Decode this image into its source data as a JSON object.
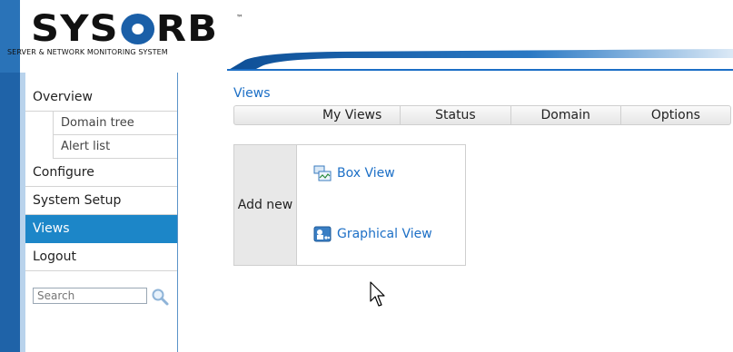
{
  "brand": {
    "name_part1": "SYS",
    "name_part2": "RB",
    "trademark": "™",
    "subtitle": "SERVER & NETWORK MONITORING SYSTEM"
  },
  "sidebar": {
    "items": [
      {
        "label": "Overview",
        "active": false
      },
      {
        "label": "Domain tree",
        "sub": true
      },
      {
        "label": "Alert list",
        "sub": true
      },
      {
        "label": "Configure",
        "active": false
      },
      {
        "label": "System Setup",
        "active": false
      },
      {
        "label": "Views",
        "active": true
      },
      {
        "label": "Logout",
        "active": false
      }
    ],
    "search_placeholder": "Search"
  },
  "main": {
    "section_title": "Views",
    "tabs": [
      "My Views",
      "Status",
      "Domain",
      "Options"
    ],
    "panel": {
      "label": "Add new",
      "links": [
        {
          "label": "Box View",
          "icon": "box-view-icon"
        },
        {
          "label": "Graphical View",
          "icon": "graphical-view-icon"
        }
      ]
    }
  },
  "colors": {
    "accent_blue": "#1c86c8",
    "link_blue": "#1c6fc6",
    "sidebar_bar": "#1f63a8"
  }
}
